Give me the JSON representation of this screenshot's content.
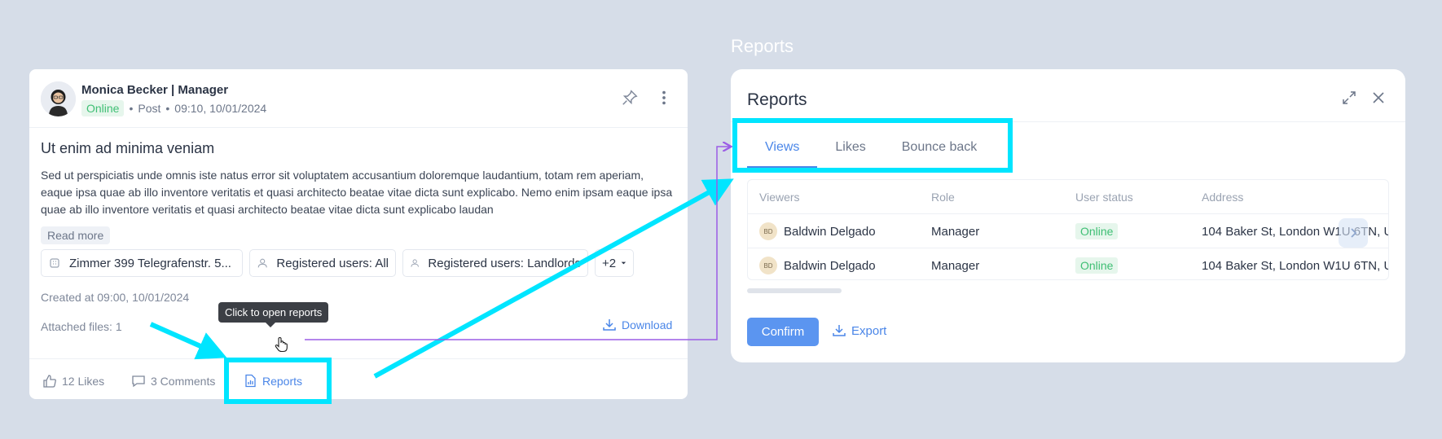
{
  "caption": "Reports",
  "post": {
    "author": "Monica Becker | Manager",
    "status": "Online",
    "type": "Post",
    "datetime": "09:10, 10/01/2024",
    "title": "Ut enim ad minima veniam",
    "body": "Sed ut perspiciatis unde omnis iste natus error sit voluptatem accusantium doloremque laudantium, totam rem aperiam, eaque ipsa quae ab illo inventore veritatis et quasi architecto beatae vitae dicta sunt explicabo. Nemo enim ipsam eaque ipsa quae ab illo inventore veritatis et quasi architecto beatae vitae dicta sunt explicabo laudan",
    "read_more": "Read more",
    "chips": [
      {
        "label": "Zimmer 399 Telegrafenstr. 5...",
        "icon": "building-icon"
      },
      {
        "label": "Registered users: All",
        "icon": "user-icon"
      },
      {
        "label": "Registered users: Landlords",
        "icon": "user-icon"
      }
    ],
    "chips_more": "+2",
    "created": "Created at 09:00, 10/01/2024",
    "attached": "Attached files: 1",
    "download": "Download",
    "tooltip": "Click to open reports",
    "likes": "12 Likes",
    "comments": "3 Comments",
    "reports": "Reports"
  },
  "panel": {
    "title": "Reports",
    "tabs": [
      "Views",
      "Likes",
      "Bounce back"
    ],
    "active_tab": "Views",
    "columns": [
      "Viewers",
      "Role",
      "User status",
      "Address"
    ],
    "rows": [
      {
        "initials": "BD",
        "name": "Baldwin Delgado",
        "role": "Manager",
        "status": "Online",
        "address": "104 Baker St, London W1U 6TN, U"
      },
      {
        "initials": "BD",
        "name": "Baldwin Delgado",
        "role": "Manager",
        "status": "Online",
        "address": "104 Baker St, London W1U 6TN, U"
      }
    ],
    "confirm": "Confirm",
    "export": "Export"
  },
  "colors": {
    "accent": "#4a86e8",
    "highlight": "#00e5ff",
    "connector": "#9b5de5",
    "online": "#3fbf74"
  }
}
